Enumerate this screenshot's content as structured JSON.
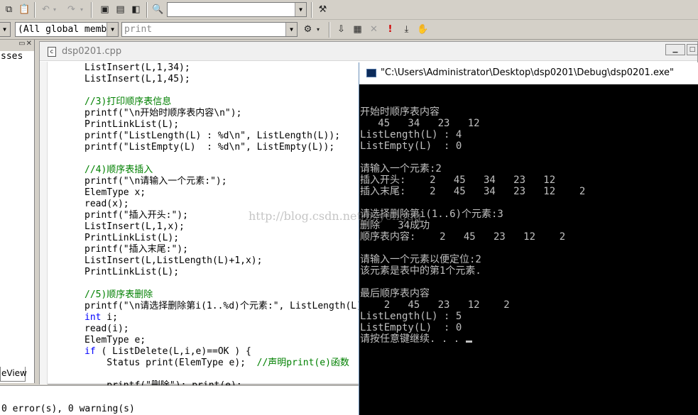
{
  "toolbar": {
    "search_value": "",
    "class_filter": "(All global members",
    "member_filter": "print"
  },
  "left_pane": {
    "tree_label": "sses",
    "tab_label": "eView"
  },
  "editor": {
    "tab_title": "dsp0201.cpp",
    "code_lines": [
      [
        {
          "t": "ListInsert(L,1,34);"
        }
      ],
      [
        {
          "t": "ListInsert(L,1,45);"
        }
      ],
      [
        {
          "t": ""
        }
      ],
      [
        {
          "t": "//3)打印顺序表信息",
          "c": "cm"
        }
      ],
      [
        {
          "t": "printf(\"\\n开始时顺序表内容\\n\");"
        }
      ],
      [
        {
          "t": "PrintLinkList(L);"
        }
      ],
      [
        {
          "t": "printf(\"ListLength(L) : %d\\n\", ListLength(L));"
        }
      ],
      [
        {
          "t": "printf(\"ListEmpty(L)  : %d\\n\", ListEmpty(L));"
        }
      ],
      [
        {
          "t": ""
        }
      ],
      [
        {
          "t": "//4)顺序表插入",
          "c": "cm"
        }
      ],
      [
        {
          "t": "printf(\"\\n请输入一个元素:\");"
        }
      ],
      [
        {
          "t": "ElemType x;"
        }
      ],
      [
        {
          "t": "read(x);"
        }
      ],
      [
        {
          "t": "printf(\"插入开头:\");"
        }
      ],
      [
        {
          "t": "ListInsert(L,1,x);"
        }
      ],
      [
        {
          "t": "PrintLinkList(L);"
        }
      ],
      [
        {
          "t": "printf(\"插入末尾:\");"
        }
      ],
      [
        {
          "t": "ListInsert(L,ListLength(L)+1,x);"
        }
      ],
      [
        {
          "t": "PrintLinkList(L);"
        }
      ],
      [
        {
          "t": ""
        }
      ],
      [
        {
          "t": "//5)顺序表删除",
          "c": "cm"
        }
      ],
      [
        {
          "t": "printf(\"\\n请选择删除第i(1..%d)个元素:\", ListLength(L));"
        }
      ],
      [
        {
          "t": "int",
          "c": "kw"
        },
        {
          "t": " i;"
        }
      ],
      [
        {
          "t": "read(i);"
        }
      ],
      [
        {
          "t": "ElemType e;"
        }
      ],
      [
        {
          "t": "if",
          "c": "kw"
        },
        {
          "t": " ( ListDelete(L,i,e)==OK ) {"
        }
      ],
      [
        {
          "t": "    Status print(ElemType e);  "
        },
        {
          "t": "//声明print(e)函数",
          "c": "cm"
        }
      ],
      [
        {
          "t": ""
        }
      ],
      [
        {
          "t": "    printf(\"删除\"); print(e);"
        }
      ]
    ]
  },
  "output": {
    "build_result": "0 error(s), 0 warning(s)"
  },
  "console": {
    "title": "\"C:\\Users\\Administrator\\Desktop\\dsp0201\\Debug\\dsp0201.exe\"",
    "lines": [
      "",
      "开始时顺序表内容",
      "   45   34   23   12",
      "ListLength(L) : 4",
      "ListEmpty(L)  : 0",
      "",
      "请输入一个元素:2",
      "插入开头:    2   45   34   23   12",
      "插入末尾:    2   45   34   23   12    2",
      "",
      "请选择删除第i(1..6)个元素:3",
      "删除   34成功",
      "顺序表内容:    2   45   23   12    2",
      "",
      "请输入一个元素以便定位:2",
      "该元素是表中的第1个元素.",
      "",
      "最后顺序表内容",
      "    2   45   23   12    2",
      "ListLength(L) : 5",
      "ListEmpty(L)  : 0",
      "请按任意键继续. . . "
    ]
  },
  "watermark": "http://blog.csdn.net/bxyongqq"
}
